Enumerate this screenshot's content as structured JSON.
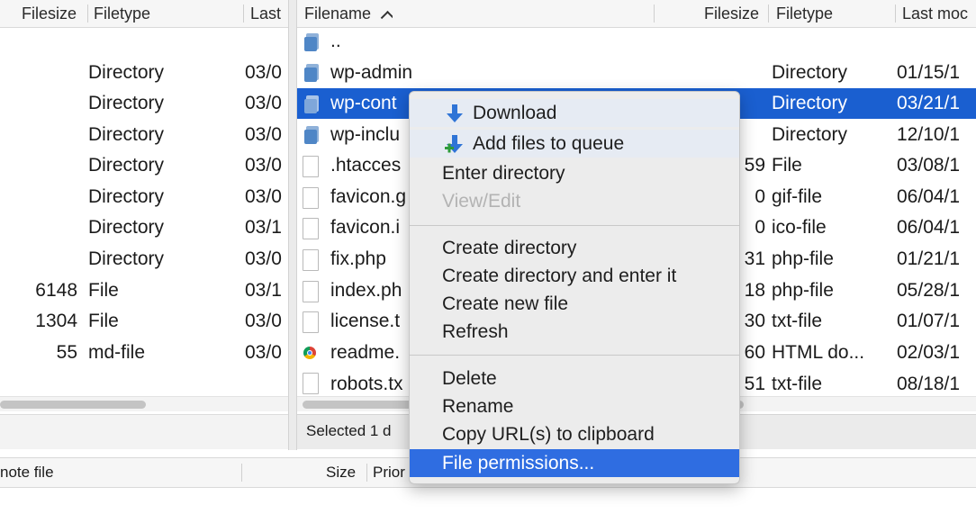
{
  "colors": {
    "selection": "#1a5fd0",
    "menu_highlight": "#2f6de1",
    "folder": "#4f86c6"
  },
  "local": {
    "headers": {
      "filesize": "Filesize",
      "filetype": "Filetype",
      "last": "Last"
    },
    "rows": [
      {
        "size": "",
        "type": "Directory",
        "date": "03/0"
      },
      {
        "size": "",
        "type": "Directory",
        "date": "03/0"
      },
      {
        "size": "",
        "type": "Directory",
        "date": "03/0"
      },
      {
        "size": "",
        "type": "Directory",
        "date": "03/0"
      },
      {
        "size": "",
        "type": "Directory",
        "date": "03/0"
      },
      {
        "size": "",
        "type": "Directory",
        "date": "03/1"
      },
      {
        "size": "",
        "type": "Directory",
        "date": "03/0"
      },
      {
        "size": "6148",
        "type": "File",
        "date": "03/1"
      },
      {
        "size": "1304",
        "type": "File",
        "date": "03/0"
      },
      {
        "size": "55",
        "type": "md-file",
        "date": "03/0"
      }
    ]
  },
  "remote": {
    "headers": {
      "filename": "Filename",
      "filesize": "Filesize",
      "filetype": "Filetype",
      "last": "Last moc"
    },
    "rows": [
      {
        "icon": "folder-icon",
        "name": "..",
        "size": "",
        "type": "",
        "date": ""
      },
      {
        "icon": "folder-icon",
        "name": "wp-admin",
        "size": "",
        "type": "Directory",
        "date": "01/15/1"
      },
      {
        "icon": "folder-icon",
        "name": "wp-cont",
        "size": "",
        "type": "Directory",
        "date": "03/21/1"
      },
      {
        "icon": "folder-icon",
        "name": "wp-inclu",
        "size": "",
        "type": "Directory",
        "date": "12/10/1"
      },
      {
        "icon": "file-icon",
        "name": ".htacces",
        "size": "59",
        "type": "File",
        "date": "03/08/1"
      },
      {
        "icon": "file-icon",
        "name": "favicon.g",
        "size": "0",
        "type": "gif-file",
        "date": "06/04/1"
      },
      {
        "icon": "file-icon",
        "name": "favicon.i",
        "size": "0",
        "type": "ico-file",
        "date": "06/04/1"
      },
      {
        "icon": "file-icon",
        "name": "fix.php",
        "size": "31",
        "type": "php-file",
        "date": "01/21/1"
      },
      {
        "icon": "file-icon",
        "name": "index.ph",
        "size": "18",
        "type": "php-file",
        "date": "05/28/1"
      },
      {
        "icon": "file-icon",
        "name": "license.t",
        "size": "30",
        "type": "txt-file",
        "date": "01/07/1"
      },
      {
        "icon": "chrome-icon",
        "name": "readme.",
        "size": "60",
        "type": "HTML do...",
        "date": "02/03/1"
      },
      {
        "icon": "file-icon",
        "name": "robots.tx",
        "size": "51",
        "type": "txt-file",
        "date": "08/18/1"
      }
    ],
    "status": "Selected 1 d"
  },
  "queue": {
    "remote_file": "note file",
    "size": "Size",
    "priority": "Prior"
  },
  "menu": {
    "download": "Download",
    "add_to_queue": "Add files to queue",
    "enter_directory": "Enter directory",
    "view_edit": "View/Edit",
    "create_directory": "Create directory",
    "create_directory_enter": "Create directory and enter it",
    "create_new_file": "Create new file",
    "refresh": "Refresh",
    "delete": "Delete",
    "rename": "Rename",
    "copy_url": "Copy URL(s) to clipboard",
    "file_permissions": "File permissions..."
  }
}
